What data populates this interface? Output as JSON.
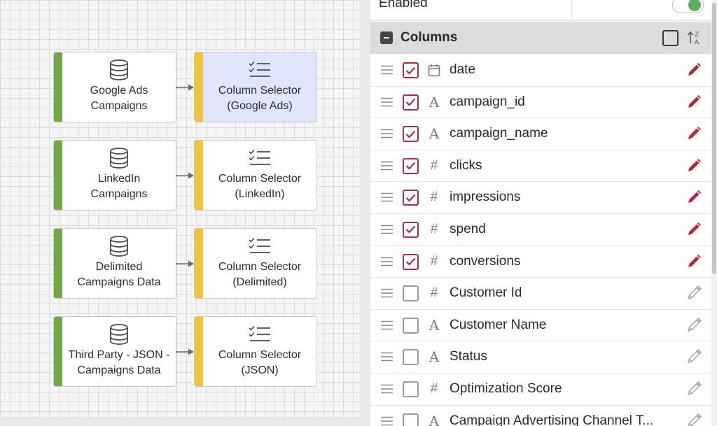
{
  "pipeline": {
    "nodes": [
      {
        "source": {
          "label_line1": "Google Ads",
          "label_line2": "Campaigns",
          "icon": "database-icon"
        },
        "transform": {
          "label_line1": "Column Selector",
          "label_line2": "(Google Ads)",
          "icon": "checklist-icon",
          "selected": true
        }
      },
      {
        "source": {
          "label_line1": "LinkedIn",
          "label_line2": "Campaigns",
          "icon": "database-icon"
        },
        "transform": {
          "label_line1": "Column Selector",
          "label_line2": "(LinkedIn)",
          "icon": "checklist-icon",
          "selected": false
        }
      },
      {
        "source": {
          "label_line1": "Delimited",
          "label_line2": "Campaigns Data",
          "icon": "database-icon"
        },
        "transform": {
          "label_line1": "Column Selector",
          "label_line2": "(Delimited)",
          "icon": "checklist-icon",
          "selected": false
        }
      },
      {
        "source": {
          "label_line1": "Third Party - JSON -",
          "label_line2": "Campaigns Data",
          "icon": "database-icon"
        },
        "transform": {
          "label_line1": "Column Selector",
          "label_line2": "(JSON)",
          "icon": "checklist-icon",
          "selected": false
        }
      }
    ],
    "colors": {
      "source_bar": "#72a843",
      "transform_bar": "#f0c43a",
      "selected_bg": "#dfe6fb"
    }
  },
  "panel": {
    "enabled_label": "Enabled",
    "enabled_on": true,
    "section_title": "Columns",
    "columns": [
      {
        "name": "date",
        "type": "date",
        "checked": true
      },
      {
        "name": "campaign_id",
        "type": "text",
        "checked": true
      },
      {
        "name": "campaign_name",
        "type": "text",
        "checked": true
      },
      {
        "name": "clicks",
        "type": "number",
        "checked": true
      },
      {
        "name": "impressions",
        "type": "number",
        "checked": true
      },
      {
        "name": "spend",
        "type": "number",
        "checked": true
      },
      {
        "name": "conversions",
        "type": "number",
        "checked": true
      },
      {
        "name": "Customer Id",
        "type": "number",
        "checked": false
      },
      {
        "name": "Customer Name",
        "type": "text",
        "checked": false
      },
      {
        "name": "Status",
        "type": "text",
        "checked": false
      },
      {
        "name": "Optimization Score",
        "type": "number",
        "checked": false
      },
      {
        "name": "Campaign Advertising Channel T...",
        "type": "text",
        "checked": false
      }
    ],
    "colors": {
      "checked": "#a8303f",
      "edit_active": "#b3283a",
      "edit_inactive": "#a0a0a6",
      "toggle_on": "#5cae5c"
    }
  }
}
